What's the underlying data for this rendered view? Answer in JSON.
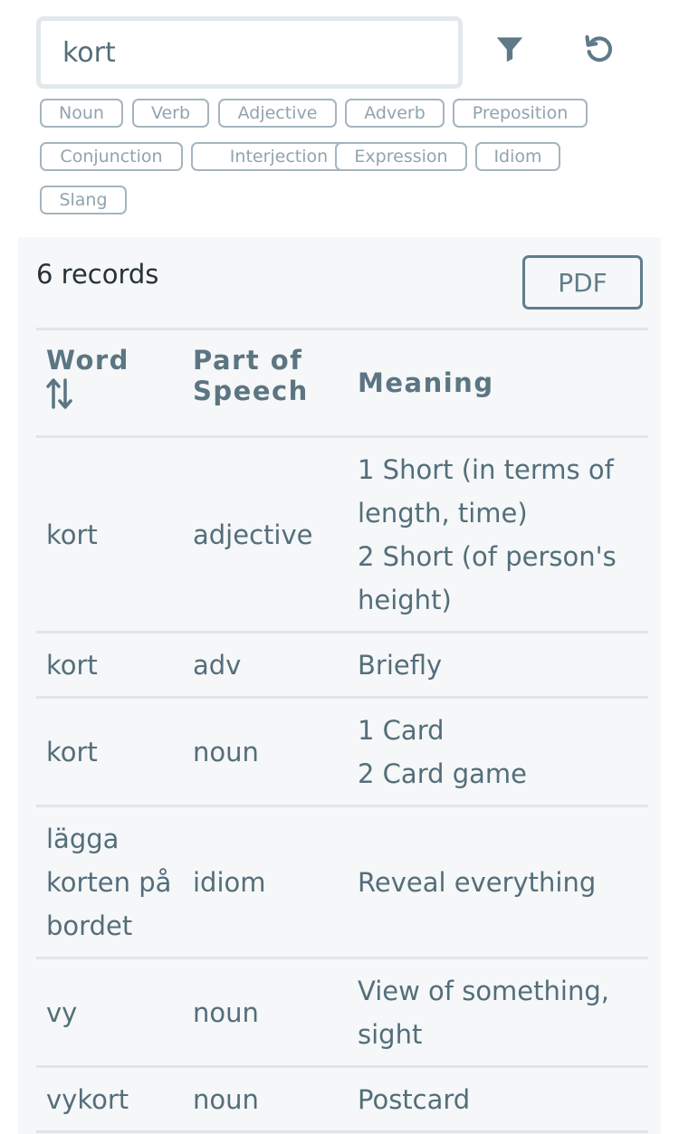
{
  "search": {
    "value": "kort",
    "placeholder": ""
  },
  "icons": {
    "filter": "filter-icon",
    "reset": "reset-icon",
    "sort": "sort-icon"
  },
  "tags": [
    {
      "label": "Noun"
    },
    {
      "label": "Verb"
    },
    {
      "label": "Adjective"
    },
    {
      "label": "Adverb"
    },
    {
      "label": "Preposition"
    },
    {
      "label": "Conjunction"
    },
    {
      "label": "Interjection"
    },
    {
      "label": "Expression"
    },
    {
      "label": "Idiom"
    },
    {
      "label": "Slang"
    }
  ],
  "results": {
    "count_label": "6 records",
    "pdf_label": "PDF"
  },
  "table": {
    "headers": {
      "word": "Word",
      "part_of_speech_line1": "Part of",
      "part_of_speech_line2": "Speech",
      "meaning": "Meaning"
    },
    "rows": [
      {
        "word_lines": [
          "kort"
        ],
        "pos": "adjective",
        "meaning_lines": [
          "1 Short (in terms of",
          "length, time)",
          "2 Short (of person's",
          "height)"
        ]
      },
      {
        "word_lines": [
          "kort"
        ],
        "pos": "adv",
        "meaning_lines": [
          "Briefly"
        ]
      },
      {
        "word_lines": [
          "kort"
        ],
        "pos": "noun",
        "meaning_lines": [
          "1 Card",
          "2 Card game"
        ]
      },
      {
        "word_lines": [
          "lägga",
          "korten på",
          "bordet"
        ],
        "pos": "idiom",
        "meaning_lines": [
          "Reveal everything"
        ]
      },
      {
        "word_lines": [
          "vy"
        ],
        "pos": "noun",
        "meaning_lines": [
          "View of something,",
          "sight"
        ]
      },
      {
        "word_lines": [
          "vykort"
        ],
        "pos": "noun",
        "meaning_lines": [
          "Postcard"
        ]
      }
    ]
  },
  "colors": {
    "text": "#546e7a",
    "tag_border": "#a5b5bd",
    "panel_bg": "#f5f7f8",
    "divider": "#dfe5e8"
  }
}
